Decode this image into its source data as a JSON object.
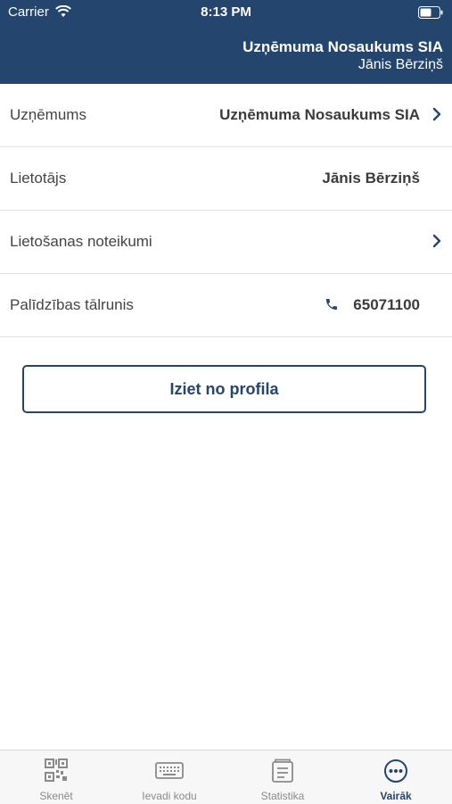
{
  "status_bar": {
    "carrier": "Carrier",
    "time": "8:13 PM"
  },
  "header": {
    "company": "Uzņēmuma Nosaukums SIA",
    "user": "Jānis Bērziņš"
  },
  "rows": [
    {
      "label": "Uzņēmums",
      "value": "Uzņēmuma Nosaukums SIA"
    },
    {
      "label": "Lietotājs",
      "value": "Jānis Bērziņš"
    },
    {
      "label": "Lietošanas noteikumi",
      "value": ""
    },
    {
      "label": "Palīdzības tālrunis",
      "value": "65071100"
    }
  ],
  "logout_label": "Iziet no profila",
  "tabs": [
    {
      "label": "Skenēt",
      "icon": "qr-code-icon"
    },
    {
      "label": "Ievadi kodu",
      "icon": "keyboard-icon"
    },
    {
      "label": "Statistika",
      "icon": "statistics-icon"
    },
    {
      "label": "Vairāk",
      "icon": "more-icon"
    }
  ],
  "colors": {
    "primary": "#24456e",
    "tab_inactive": "#8a8a8a"
  }
}
